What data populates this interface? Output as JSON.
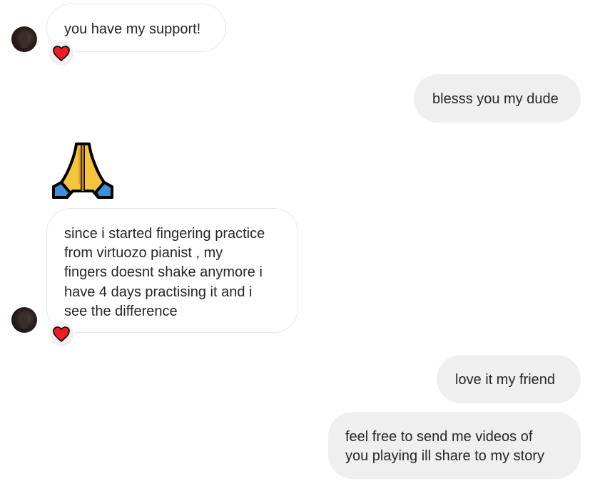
{
  "messages": [
    {
      "side": "in",
      "text": "you have my support!",
      "reaction": "heart"
    },
    {
      "side": "out",
      "text": "blesss you my dude"
    },
    {
      "side": "in",
      "emoji": "folded-hands"
    },
    {
      "side": "in",
      "text": "since i started fingering practice\nfrom virtuozo pianist , my\nfingers doesnt shake anymore i\nhave 4 days practising it and i\nsee the difference",
      "reaction": "heart"
    },
    {
      "side": "out",
      "text": "love it my friend"
    },
    {
      "side": "out",
      "text": "feel free to send me videos of\nyou playing ill share to my story"
    }
  ],
  "colors": {
    "incoming_bg": "#ffffff",
    "incoming_border": "#e6e6e6",
    "outgoing_bg": "#efefef",
    "text": "#262626",
    "heart": "#ed1c24"
  }
}
